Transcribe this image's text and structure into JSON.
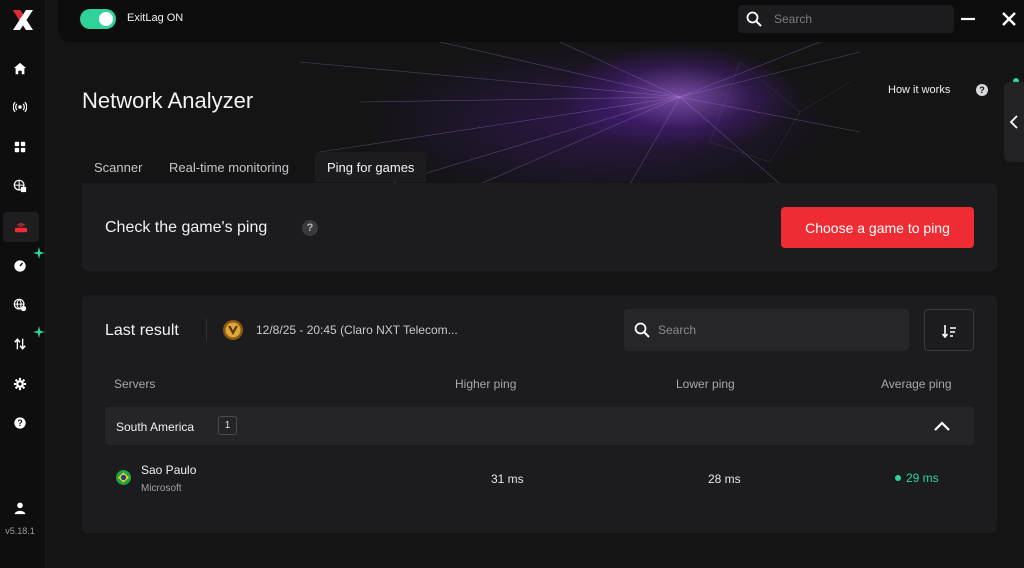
{
  "app": {
    "version": "v5.18.1"
  },
  "topbar": {
    "toggle_label": "ExitLag ON",
    "toggle_on": true,
    "search_placeholder": "Search"
  },
  "page": {
    "title": "Network Analyzer",
    "how_it_works": "How it works",
    "tabs": [
      {
        "label": "Scanner"
      },
      {
        "label": "Real-time monitoring"
      },
      {
        "label": "Ping for games"
      }
    ],
    "active_tab": "Ping for games"
  },
  "ping_card": {
    "title": "Check the game's ping",
    "help_icon": "question-icon",
    "cta_label": "Choose a game to ping"
  },
  "results": {
    "title": "Last result",
    "meta": "12/8/25 - 20:45 (Claro NXT Telecom...",
    "search_placeholder": "Search",
    "columns": [
      "Servers",
      "Higher ping",
      "Lower ping",
      "Average ping"
    ],
    "regions": [
      {
        "name": "South America",
        "count": "1",
        "servers": [
          {
            "name": "Sao Paulo",
            "provider": "Microsoft",
            "higher": "31 ms",
            "lower": "28 ms",
            "average": "29 ms"
          }
        ]
      }
    ]
  },
  "colors": {
    "accent_red": "#ef2b34",
    "accent_green": "#2fd39a",
    "background": "#141415",
    "card": "#1c1c1e"
  },
  "icons": [
    "logo-icon",
    "home-icon",
    "broadcast-icon",
    "grid-icon",
    "globe-network-icon",
    "router-icon",
    "speed-icon",
    "world-lock-icon",
    "transfer-icon",
    "settings-icon",
    "help-icon",
    "user-icon",
    "search-icon",
    "minimize-icon",
    "close-icon",
    "sort-icon",
    "chevron-up-icon",
    "brazil-flag-icon"
  ]
}
